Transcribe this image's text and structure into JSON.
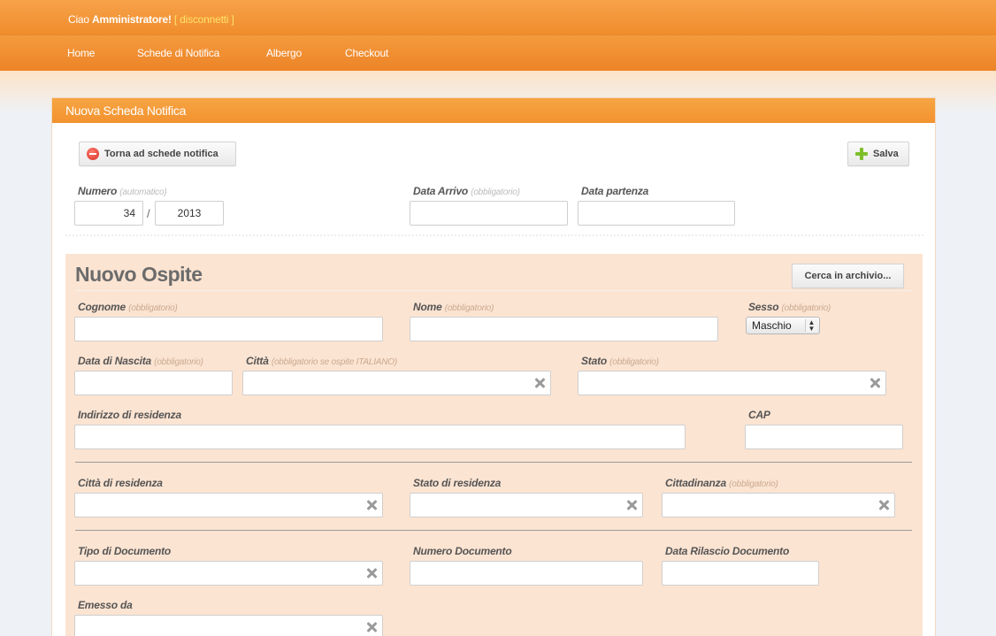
{
  "header": {
    "greeting_prefix": "Ciao",
    "username": "Amministratore",
    "excl": "!",
    "bracket_open": "[",
    "logout_label": "disconnetti",
    "bracket_close": "]"
  },
  "nav": {
    "items": [
      {
        "label": "Home"
      },
      {
        "label": "Schede di Notifica"
      },
      {
        "label": "Albergo"
      },
      {
        "label": "Checkout"
      }
    ]
  },
  "panel": {
    "title": "Nuova Scheda Notifica",
    "back_button": "Torna ad schede notifica",
    "save_button": "Salva"
  },
  "scheda": {
    "numero_label": "Numero",
    "numero_hint": "(automatico)",
    "numero_value": "34",
    "slash": "/",
    "anno_value": "2013",
    "data_arrivo_label": "Data Arrivo",
    "data_arrivo_hint": "(obbligatorio)",
    "data_arrivo_value": "",
    "data_partenza_label": "Data partenza",
    "data_partenza_value": ""
  },
  "guest": {
    "title": "Nuovo Ospite",
    "search_archive_button": "Cerca in archivio...",
    "cognome_label": "Cognome",
    "cognome_hint": "(obbligatorio)",
    "nome_label": "Nome",
    "nome_hint": "(obbligatorio)",
    "sesso_label": "Sesso",
    "sesso_hint": "(obbligatorio)",
    "sesso_value": "Maschio",
    "data_nascita_label": "Data di Nascita",
    "data_nascita_hint": "(obbligatorio)",
    "citta_label": "Città",
    "citta_hint": "(obbligatorio se ospite ITALIANO)",
    "stato_label": "Stato",
    "stato_hint": "(obbligatorio)",
    "indirizzo_label": "Indirizzo di residenza",
    "cap_label": "CAP",
    "citta_residenza_label": "Città di residenza",
    "stato_residenza_label": "Stato di residenza",
    "cittadinanza_label": "Cittadinanza",
    "cittadinanza_hint": "(obbligatorio)",
    "tipo_documento_label": "Tipo di Documento",
    "numero_documento_label": "Numero Documento",
    "data_rilascio_label": "Data Rilascio Documento",
    "emesso_da_label": "Emesso da"
  },
  "icons": {
    "back": "minus-circle-icon",
    "save": "plus-icon",
    "clear": "clear-x-icon"
  },
  "colors": {
    "accent": "#f39230",
    "guest_bg": "#fce4d2",
    "logout_link": "#ffe36b"
  }
}
